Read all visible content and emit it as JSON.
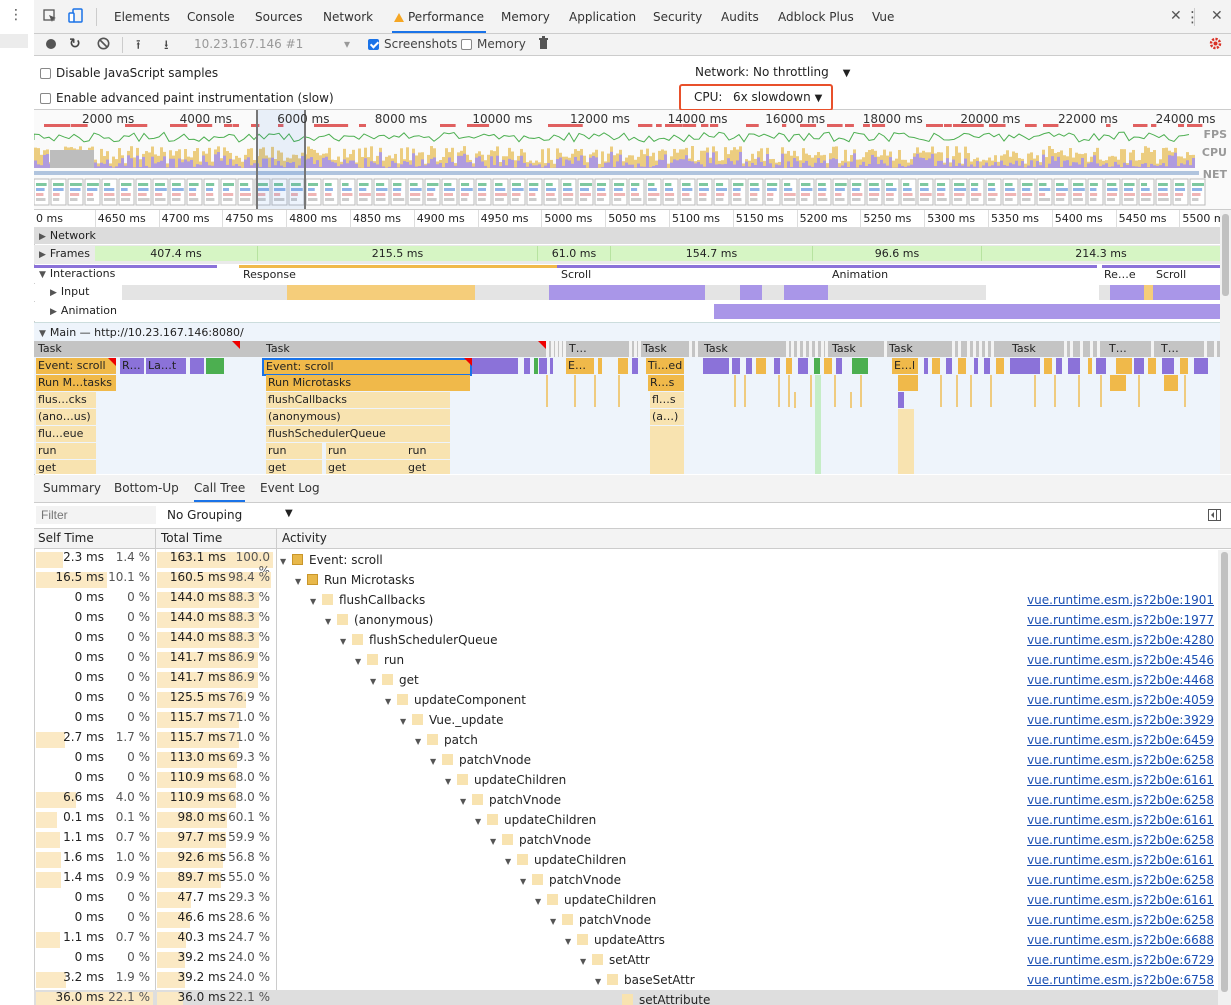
{
  "tabs": [
    "Elements",
    "Console",
    "Sources",
    "Network",
    "Performance",
    "Memory",
    "Application",
    "Security",
    "Audits",
    "Adblock Plus",
    "Vue"
  ],
  "toolbar": {
    "profile": "10.23.167.146 #1",
    "screenshots_label": "Screenshots",
    "memory_label": "Memory"
  },
  "settings": {
    "disable_js_samples": "Disable JavaScript samples",
    "advanced_paint": "Enable advanced paint instrumentation (slow)",
    "network_label": "Network:",
    "network_value": "No throttling",
    "cpu_label": "CPU:",
    "cpu_value": "6x slowdown"
  },
  "overview": {
    "ticks": [
      "2000 ms",
      "4000 ms",
      "6000 ms",
      "8000 ms",
      "10000 ms",
      "12000 ms",
      "14000 ms",
      "16000 ms",
      "18000 ms",
      "20000 ms",
      "22000 ms",
      "24000 ms"
    ],
    "labels": {
      "fps": "FPS",
      "cpu": "CPU",
      "net": "NET"
    }
  },
  "ruler": [
    "0 ms",
    "4650 ms",
    "4700 ms",
    "4750 ms",
    "4800 ms",
    "4850 ms",
    "4900 ms",
    "4950 ms",
    "5000 ms",
    "5050 ms",
    "5100 ms",
    "5150 ms",
    "5200 ms",
    "5250 ms",
    "5300 ms",
    "5350 ms",
    "5400 ms",
    "5450 ms",
    "5500 ms"
  ],
  "tracks": {
    "network": "Network",
    "frames": "Frames",
    "frame_values": [
      "407.4 ms",
      "215.5 ms",
      "61.0 ms",
      "154.7 ms",
      "96.6 ms",
      "214.3 ms"
    ],
    "interactions": "Interactions",
    "interaction_labels": [
      "Response",
      "Scroll",
      "Animation",
      "Re…e",
      "Scroll"
    ],
    "input": "Input",
    "animation": "Animation",
    "main": "Main — http://10.23.167.146:8080/"
  },
  "flame": {
    "task_labels": [
      "Task",
      "Task",
      "T…",
      "Task",
      "Task",
      "Task",
      "Task",
      "Task",
      "T…",
      "T…"
    ],
    "left_col": [
      "Event: scroll",
      "Run M…tasks",
      "flus…cks",
      "(ano…us)",
      "flu…eue",
      "run",
      "get"
    ],
    "left_col2": [
      "R…",
      "La…t"
    ],
    "center_col": [
      "Event: scroll",
      "Run Microtasks",
      "flushCallbacks",
      "(anonymous)",
      "flushSchedulerQueue",
      "run",
      "get"
    ],
    "center_extra": [
      "run",
      "run",
      "get",
      "get"
    ],
    "right_small": [
      "E…",
      "Ti…ed",
      "R…s",
      "fl…s",
      "(a…)",
      "E…l"
    ]
  },
  "bottom": {
    "subtabs": [
      "Summary",
      "Bottom-Up",
      "Call Tree",
      "Event Log"
    ],
    "filter_placeholder": "Filter",
    "grouping": "No Grouping",
    "columns": {
      "self": "Self Time",
      "total": "Total Time",
      "activity": "Activity"
    },
    "rows": [
      {
        "self": "2.3 ms",
        "sp": "1.4 %",
        "total": "163.1 ms",
        "tp": "100.0 %",
        "act": "Event: scroll",
        "d": 0,
        "c": "#e8b84a",
        "src": "",
        "sf": 1.4,
        "tf": 100
      },
      {
        "self": "16.5 ms",
        "sp": "10.1 %",
        "total": "160.5 ms",
        "tp": "98.4 %",
        "act": "Run Microtasks",
        "d": 1,
        "c": "#e8b84a",
        "src": "",
        "sf": 10.1,
        "tf": 98.4
      },
      {
        "self": "0 ms",
        "sp": "0 %",
        "total": "144.0 ms",
        "tp": "88.3 %",
        "act": "flushCallbacks",
        "d": 2,
        "c": "#f8e3b0",
        "src": "vue.runtime.esm.js?2b0e:1901",
        "sf": 0,
        "tf": 88.3
      },
      {
        "self": "0 ms",
        "sp": "0 %",
        "total": "144.0 ms",
        "tp": "88.3 %",
        "act": "(anonymous)",
        "d": 3,
        "c": "#f8e3b0",
        "src": "vue.runtime.esm.js?2b0e:1977",
        "sf": 0,
        "tf": 88.3
      },
      {
        "self": "0 ms",
        "sp": "0 %",
        "total": "144.0 ms",
        "tp": "88.3 %",
        "act": "flushSchedulerQueue",
        "d": 4,
        "c": "#f8e3b0",
        "src": "vue.runtime.esm.js?2b0e:4280",
        "sf": 0,
        "tf": 88.3
      },
      {
        "self": "0 ms",
        "sp": "0 %",
        "total": "141.7 ms",
        "tp": "86.9 %",
        "act": "run",
        "d": 5,
        "c": "#f8e3b0",
        "src": "vue.runtime.esm.js?2b0e:4546",
        "sf": 0,
        "tf": 86.9
      },
      {
        "self": "0 ms",
        "sp": "0 %",
        "total": "141.7 ms",
        "tp": "86.9 %",
        "act": "get",
        "d": 6,
        "c": "#f8e3b0",
        "src": "vue.runtime.esm.js?2b0e:4468",
        "sf": 0,
        "tf": 86.9
      },
      {
        "self": "0 ms",
        "sp": "0 %",
        "total": "125.5 ms",
        "tp": "76.9 %",
        "act": "updateComponent",
        "d": 7,
        "c": "#f8e3b0",
        "src": "vue.runtime.esm.js?2b0e:4059",
        "sf": 0,
        "tf": 76.9
      },
      {
        "self": "0 ms",
        "sp": "0 %",
        "total": "115.7 ms",
        "tp": "71.0 %",
        "act": "Vue._update",
        "d": 8,
        "c": "#f8e3b0",
        "src": "vue.runtime.esm.js?2b0e:3929",
        "sf": 0,
        "tf": 71.0
      },
      {
        "self": "2.7 ms",
        "sp": "1.7 %",
        "total": "115.7 ms",
        "tp": "71.0 %",
        "act": "patch",
        "d": 9,
        "c": "#f8e3b0",
        "src": "vue.runtime.esm.js?2b0e:6459",
        "sf": 1.7,
        "tf": 71.0
      },
      {
        "self": "0 ms",
        "sp": "0 %",
        "total": "113.0 ms",
        "tp": "69.3 %",
        "act": "patchVnode",
        "d": 10,
        "c": "#f8e3b0",
        "src": "vue.runtime.esm.js?2b0e:6258",
        "sf": 0,
        "tf": 69.3
      },
      {
        "self": "0 ms",
        "sp": "0 %",
        "total": "110.9 ms",
        "tp": "68.0 %",
        "act": "updateChildren",
        "d": 11,
        "c": "#f8e3b0",
        "src": "vue.runtime.esm.js?2b0e:6161",
        "sf": 0,
        "tf": 68.0
      },
      {
        "self": "6.6 ms",
        "sp": "4.0 %",
        "total": "110.9 ms",
        "tp": "68.0 %",
        "act": "patchVnode",
        "d": 12,
        "c": "#f8e3b0",
        "src": "vue.runtime.esm.js?2b0e:6258",
        "sf": 4.0,
        "tf": 68.0
      },
      {
        "self": "0.1 ms",
        "sp": "0.1 %",
        "total": "98.0 ms",
        "tp": "60.1 %",
        "act": "updateChildren",
        "d": 13,
        "c": "#f8e3b0",
        "src": "vue.runtime.esm.js?2b0e:6161",
        "sf": 0.1,
        "tf": 60.1
      },
      {
        "self": "1.1 ms",
        "sp": "0.7 %",
        "total": "97.7 ms",
        "tp": "59.9 %",
        "act": "patchVnode",
        "d": 14,
        "c": "#f8e3b0",
        "src": "vue.runtime.esm.js?2b0e:6258",
        "sf": 0.7,
        "tf": 59.9
      },
      {
        "self": "1.6 ms",
        "sp": "1.0 %",
        "total": "92.6 ms",
        "tp": "56.8 %",
        "act": "updateChildren",
        "d": 15,
        "c": "#f8e3b0",
        "src": "vue.runtime.esm.js?2b0e:6161",
        "sf": 1.0,
        "tf": 56.8
      },
      {
        "self": "1.4 ms",
        "sp": "0.9 %",
        "total": "89.7 ms",
        "tp": "55.0 %",
        "act": "patchVnode",
        "d": 16,
        "c": "#f8e3b0",
        "src": "vue.runtime.esm.js?2b0e:6258",
        "sf": 0.9,
        "tf": 55.0
      },
      {
        "self": "0 ms",
        "sp": "0 %",
        "total": "47.7 ms",
        "tp": "29.3 %",
        "act": "updateChildren",
        "d": 17,
        "c": "#f8e3b0",
        "src": "vue.runtime.esm.js?2b0e:6161",
        "sf": 0,
        "tf": 29.3
      },
      {
        "self": "0 ms",
        "sp": "0 %",
        "total": "46.6 ms",
        "tp": "28.6 %",
        "act": "patchVnode",
        "d": 18,
        "c": "#f8e3b0",
        "src": "vue.runtime.esm.js?2b0e:6258",
        "sf": 0,
        "tf": 28.6
      },
      {
        "self": "1.1 ms",
        "sp": "0.7 %",
        "total": "40.3 ms",
        "tp": "24.7 %",
        "act": "updateAttrs",
        "d": 19,
        "c": "#f8e3b0",
        "src": "vue.runtime.esm.js?2b0e:6688",
        "sf": 0.7,
        "tf": 24.7
      },
      {
        "self": "0 ms",
        "sp": "0 %",
        "total": "39.2 ms",
        "tp": "24.0 %",
        "act": "setAttr",
        "d": 20,
        "c": "#f8e3b0",
        "src": "vue.runtime.esm.js?2b0e:6729",
        "sf": 0,
        "tf": 24.0
      },
      {
        "self": "3.2 ms",
        "sp": "1.9 %",
        "total": "39.2 ms",
        "tp": "24.0 %",
        "act": "baseSetAttr",
        "d": 21,
        "c": "#f8e3b0",
        "src": "vue.runtime.esm.js?2b0e:6758",
        "sf": 1.9,
        "tf": 24.0
      },
      {
        "self": "36.0 ms",
        "sp": "22.1 %",
        "total": "36.0 ms",
        "tp": "22.1 %",
        "act": "setAttribute",
        "d": 22,
        "c": "#f8e3b0",
        "src": "",
        "sf": 22.1,
        "tf": 22.1,
        "selected": true
      }
    ]
  }
}
